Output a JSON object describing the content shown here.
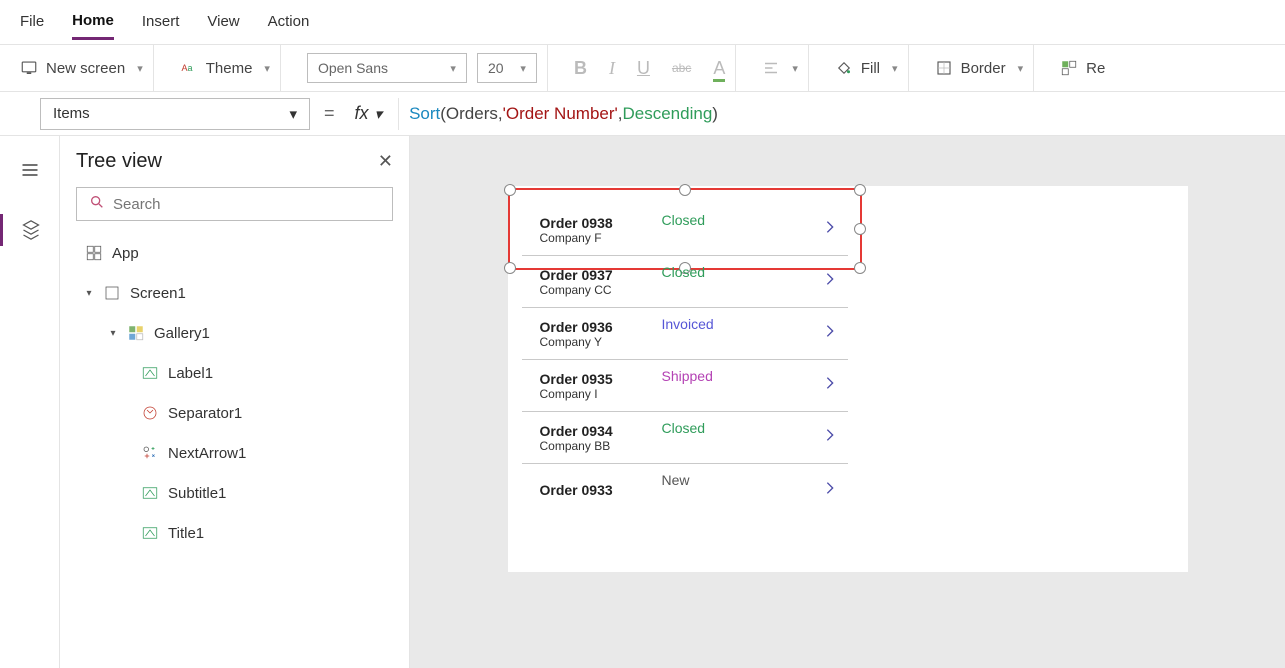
{
  "menu": {
    "items": [
      "File",
      "Home",
      "Insert",
      "View",
      "Action"
    ],
    "active": "Home"
  },
  "ribbon": {
    "new_screen": "New screen",
    "theme": "Theme",
    "font_name": "Open Sans",
    "font_size": "20",
    "bold": "B",
    "italic": "I",
    "underline": "U",
    "strike": "abc",
    "font_color": "A",
    "fill": "Fill",
    "border": "Border",
    "realign": "Re"
  },
  "formula": {
    "property": "Items",
    "tokens": {
      "fn": "Sort",
      "open": "( ",
      "id": "Orders",
      "sep1": ", ",
      "str": "'Order Number'",
      "sep2": ", ",
      "kw": "Descending",
      "close": " )"
    }
  },
  "tree": {
    "title": "Tree view",
    "search_placeholder": "Search",
    "root": "App",
    "screen": "Screen1",
    "gallery": "Gallery1",
    "children": [
      "Label1",
      "Separator1",
      "NextArrow1",
      "Subtitle1",
      "Title1"
    ]
  },
  "gallery_rows": [
    {
      "title": "Order 0938",
      "sub": "Company F",
      "status": "Closed"
    },
    {
      "title": "Order 0937",
      "sub": "Company CC",
      "status": "Closed"
    },
    {
      "title": "Order 0936",
      "sub": "Company Y",
      "status": "Invoiced"
    },
    {
      "title": "Order 0935",
      "sub": "Company I",
      "status": "Shipped"
    },
    {
      "title": "Order 0934",
      "sub": "Company BB",
      "status": "Closed"
    },
    {
      "title": "Order 0933",
      "sub": "",
      "status": "New"
    }
  ]
}
